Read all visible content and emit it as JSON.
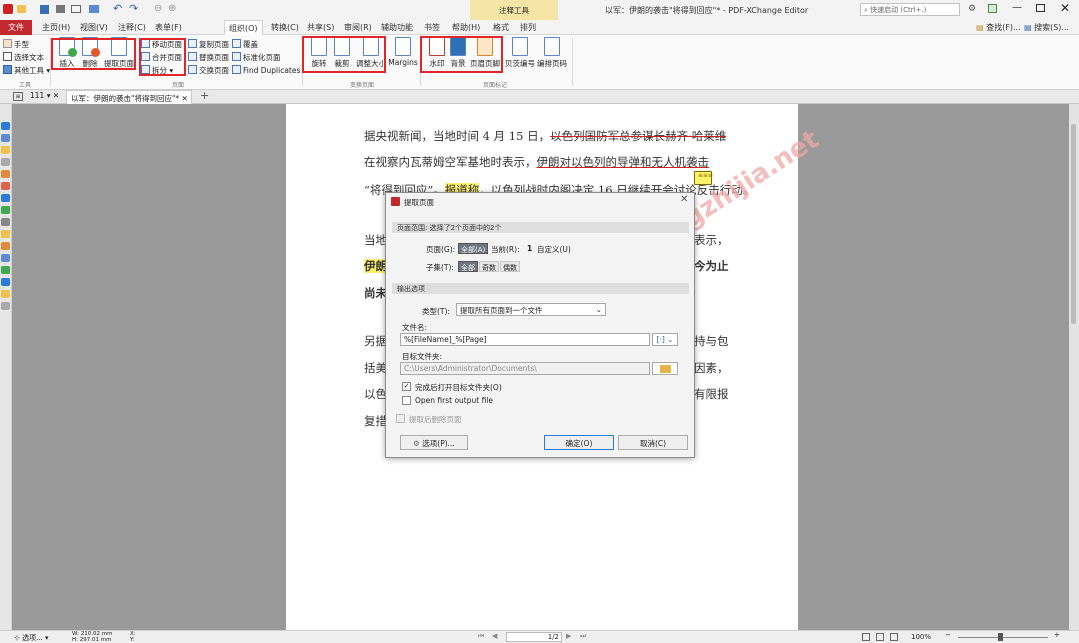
{
  "title": {
    "window": "以军：伊朗的袭击\"将得到回应\"* - PDF-XChange Editor",
    "context_tab": "注释工具",
    "quick_launch": "快速启动 (Ctrl+.)",
    "find": "查找(F)...",
    "search": "搜索(S)..."
  },
  "menu": [
    "文件",
    "主页(H)",
    "视图(V)",
    "注释(C)",
    "表单(F)",
    "组织(O)",
    "转换(C)",
    "共享(S)",
    "审阅(R)",
    "辅助功能",
    "书签",
    "帮助(H)",
    "格式",
    "排列"
  ],
  "ribbon": {
    "tools": {
      "hand": "手型",
      "select_text": "选择文本",
      "other_tools": "其他工具",
      "group": "工具"
    },
    "pages1": {
      "insert": "插入",
      "delete": "删除",
      "extract": "提取页面"
    },
    "pages2": {
      "move": "移动页面",
      "merge": "合并页面",
      "split": "拆分",
      "copy": "复制页面",
      "replace": "替换页面",
      "swap": "交换页面",
      "overlay": "覆盖",
      "normalize": "标准化页面",
      "find_dup": "Find Duplicates",
      "group": "页面"
    },
    "transform": {
      "rotate": "旋转",
      "crop": "裁剪",
      "resize": "调整大小",
      "margins": "Margins",
      "group": "变换页面"
    },
    "marks": {
      "watermark": "水印",
      "background": "背景",
      "header_footer": "页眉页脚",
      "bates": "贝茨编号",
      "page_num": "编排页码",
      "group": "页面标记"
    }
  },
  "tabs": {
    "home": "111",
    "doc": "以军：伊朗的袭击\"将得到回应\"*"
  },
  "doc": {
    "l1a": "据央视新闻，当地时间 4 月 15 日，",
    "l1b": "以色列国防军总参谋长赫齐·哈莱维",
    "l2a": "在视察内瓦蒂姆空军基地时表示，",
    "l2b": "伊朗对以色列的导弹和无人机袭击",
    "l3a": "“将得到回应”。",
    "l3b": "报道称",
    "l3c": "，以色列战时内阁决定 16 日继续开会讨论反击行动。",
    "l4a": "当地",
    "l4b": "表示，",
    "l5a": "伊朗",
    "l5b": "今为止",
    "l6a": "尚未",
    "l7a": "另据",
    "l7b": "持与包",
    "l8a": "括美",
    "l8b": "因素，",
    "l9a": "以色",
    "l9b": "有限报",
    "l10a": "复措",
    "note": "≡≡≡",
    "watermark": "系统之家 xitongzhijia.net"
  },
  "dialog": {
    "title": "提取页面",
    "range_head": "页面范围: 选择了2个页面中的2个",
    "pages_label": "页面(G):",
    "opt_all": "全部(A)",
    "opt_current": "当前(R):",
    "current_num": "1",
    "opt_custom": "自定义(U)",
    "subset_label": "子集(T):",
    "sub_all": "全部",
    "sub_odd": "奇数",
    "sub_even": "偶数",
    "output_head": "输出选项",
    "type_label": "类型(T):",
    "type_value": "提取所有页面到一个文件",
    "filename_label": "文件名:",
    "filename_value": "%[FileName]_%[Page]",
    "folder_label": "目标文件夹:",
    "folder_value": "C:\\Users\\Administrator\\Documents\\",
    "open_folder": "完成后打开目标文件夹(O)",
    "open_first": "Open first output file",
    "delete_after": "提取后删除页面",
    "options_btn": "选项(P)...",
    "ok_btn": "确定(O)",
    "cancel_btn": "取消(C)"
  },
  "status": {
    "tool": "选项...",
    "w": "W: 210.02 mm",
    "h": "H: 297.01 mm",
    "x": "X:",
    "y": "Y:",
    "page": "1/2",
    "zoom": "100%"
  }
}
